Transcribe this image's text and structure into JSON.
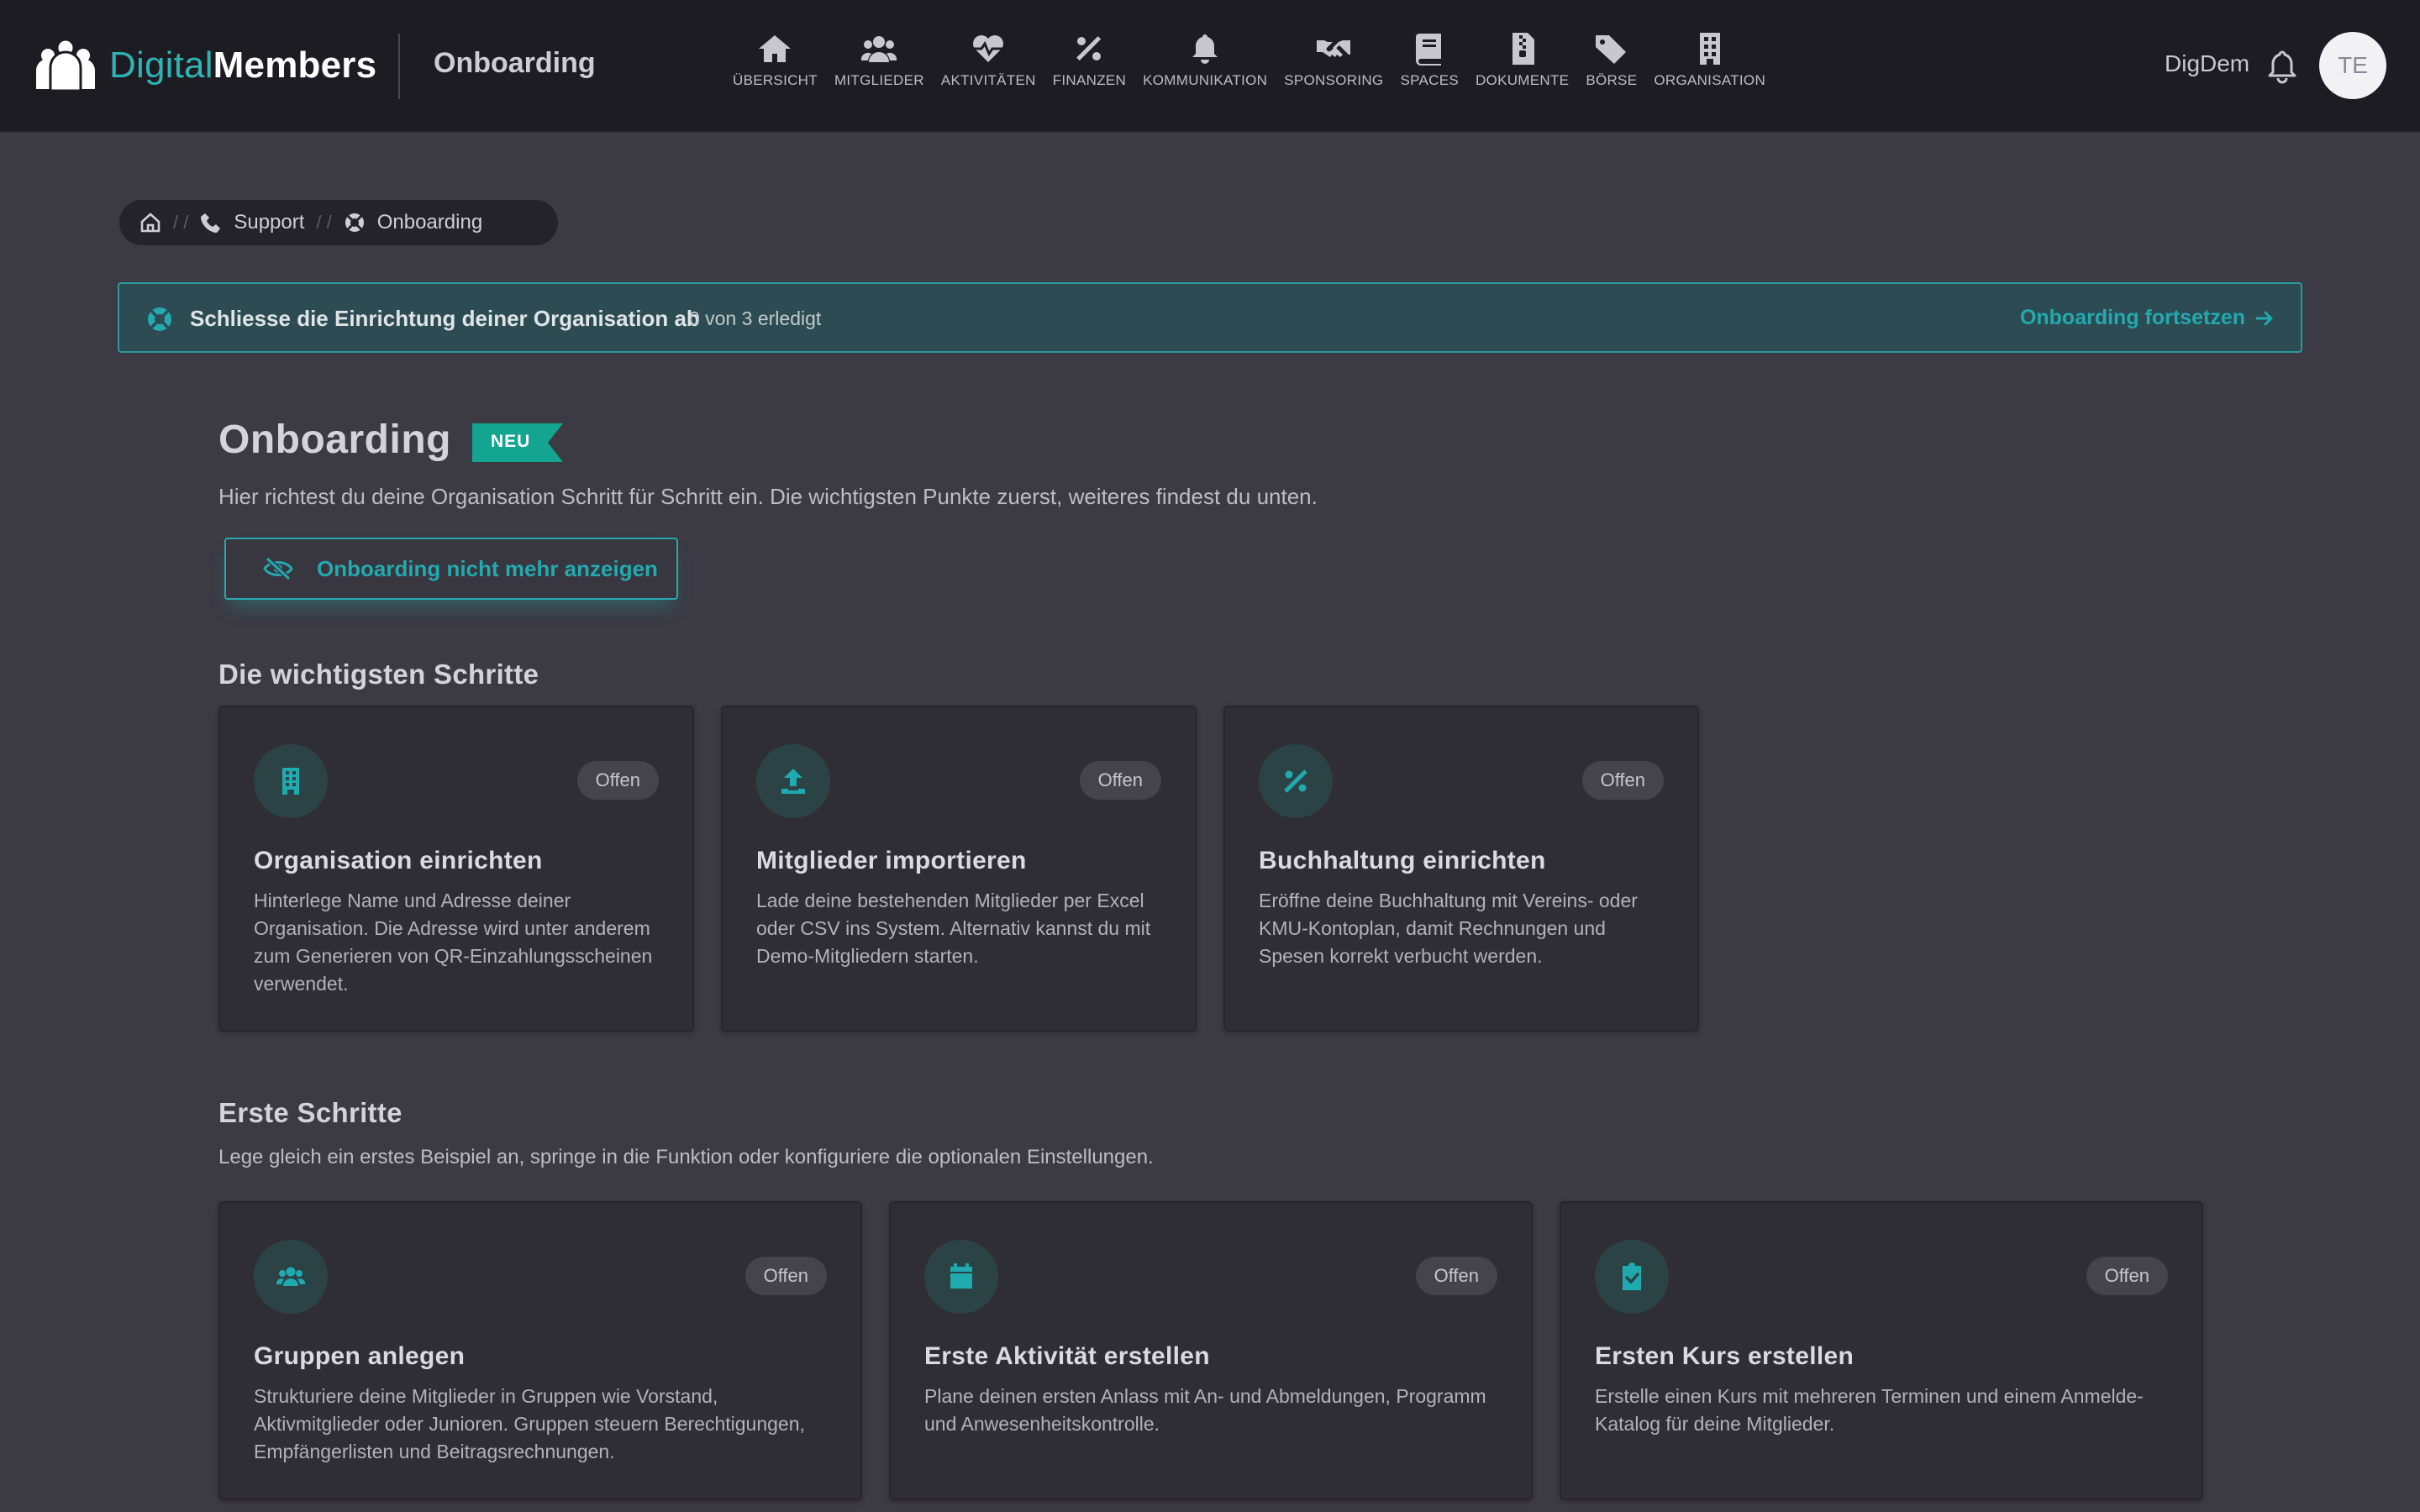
{
  "app": {
    "logo_digital": "Digital",
    "logo_members": "Members",
    "page_title": "Onboarding"
  },
  "nav": [
    {
      "label": "ÜBERSICHT",
      "icon": "home-icon"
    },
    {
      "label": "MITGLIEDER",
      "icon": "users-icon"
    },
    {
      "label": "AKTIVITÄTEN",
      "icon": "heartbeat-icon"
    },
    {
      "label": "FINANZEN",
      "icon": "percent-icon"
    },
    {
      "label": "KOMMUNIKATION",
      "icon": "bell-icon"
    },
    {
      "label": "SPONSORING",
      "icon": "handshake-icon"
    },
    {
      "label": "SPACES",
      "icon": "book-icon"
    },
    {
      "label": "DOKUMENTE",
      "icon": "file-zip-icon"
    },
    {
      "label": "BÖRSE",
      "icon": "tags-icon"
    },
    {
      "label": "ORGANISATION",
      "icon": "building-icon"
    }
  ],
  "user": {
    "name": "DigDem",
    "initials": "TE"
  },
  "breadcrumb": {
    "items": [
      "Support",
      "Onboarding"
    ]
  },
  "banner": {
    "title": "Schliesse die Einrichtung deiner Organisation ab",
    "progress": "0 von 3 erledigt",
    "progress_value": 0,
    "progress_total": 3,
    "link": "Onboarding fortsetzen"
  },
  "header": {
    "title": "Onboarding",
    "badge": "NEU",
    "intro": "Hier richtest du deine Organisation Schritt für Schritt ein. Die wichtigsten Punkte zuerst, weiteres findest du unten.",
    "hide_button": "Onboarding nicht mehr anzeigen"
  },
  "important": {
    "title": "Die wichtigsten Schritte",
    "cards": [
      {
        "icon": "building-icon",
        "status": "Offen",
        "title": "Organisation einrichten",
        "desc": "Hinterlege Name und Adresse deiner Organisation. Die Adresse wird unter anderem zum Generieren von QR-Einzahlungsscheinen verwendet."
      },
      {
        "icon": "upload-icon",
        "status": "Offen",
        "title": "Mitglieder importieren",
        "desc": "Lade deine bestehenden Mitglieder per Excel oder CSV ins System. Alternativ kannst du mit Demo-Mitgliedern starten."
      },
      {
        "icon": "percent-icon",
        "status": "Offen",
        "title": "Buchhaltung einrichten",
        "desc": "Eröffne deine Buchhaltung mit Vereins- oder KMU-Kontoplan, damit Rechnungen und Spesen korrekt verbucht werden."
      }
    ]
  },
  "first": {
    "title": "Erste Schritte",
    "subtitle": "Lege gleich ein erstes Beispiel an, springe in die Funktion oder konfiguriere die optionalen Einstellungen.",
    "cards": [
      {
        "icon": "users-icon",
        "status": "Offen",
        "title": "Gruppen anlegen",
        "desc": "Strukturiere deine Mitglieder in Gruppen wie Vorstand, Aktivmitglieder oder Junioren. Gruppen steuern Berechtigungen, Empfängerlisten und Beitragsrechnungen."
      },
      {
        "icon": "calendar-icon",
        "status": "Offen",
        "title": "Erste Aktivität erstellen",
        "desc": "Plane deinen ersten Anlass mit An- und Abmeldungen, Programm und Anwesenheitskontrolle."
      },
      {
        "icon": "clipboard-check-icon",
        "status": "Offen",
        "title": "Ersten Kurs erstellen",
        "desc": "Erstelle einen Kurs mit mehreren Terminen und einem Anmelde-Katalog für deine Mitglieder."
      }
    ]
  },
  "colors": {
    "accent": "#22aab0",
    "topbar": "#1e1c23",
    "background": "#3c3a42",
    "card": "#302e35"
  }
}
